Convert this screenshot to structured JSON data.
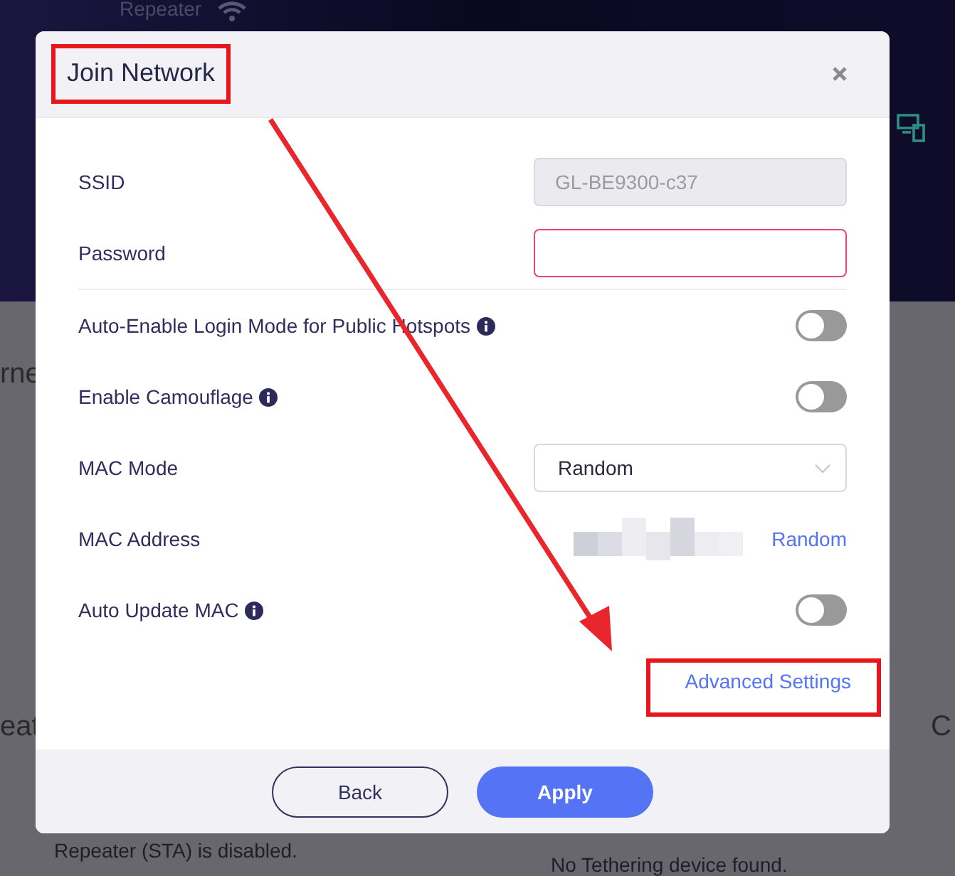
{
  "background": {
    "texts": [
      {
        "kind": "top-label",
        "text": "Repeater"
      },
      {
        "kind": "left-heading",
        "text": "rne"
      },
      {
        "kind": "left-heading-2",
        "text": "eat"
      },
      {
        "kind": "right-heading",
        "text": "C"
      },
      {
        "kind": "status-left",
        "text": "Repeater (STA) is disabled."
      },
      {
        "kind": "status-right",
        "text": "No Tethering device found."
      }
    ]
  },
  "dialog": {
    "title": "Join Network",
    "title_highlighted": true,
    "rows": [
      {
        "kind": "input",
        "label": "SSID",
        "value": "GL-BE9300-c37",
        "disabled": true,
        "invalid": false
      },
      {
        "kind": "input",
        "label": "Password",
        "value": "",
        "disabled": false,
        "invalid": true
      },
      {
        "kind": "toggle",
        "label": "Auto-Enable Login Mode for Public Hotspots",
        "info": true,
        "on": false
      },
      {
        "kind": "toggle",
        "label": "Enable Camouflage",
        "info": true,
        "on": false
      },
      {
        "kind": "select",
        "label": "MAC Mode",
        "value": "Random"
      },
      {
        "kind": "mac",
        "label": "MAC Address",
        "link": "Random"
      },
      {
        "kind": "toggle",
        "label": "Auto Update MAC",
        "info": true,
        "on": false
      }
    ],
    "advanced_link": {
      "text": "Advanced Settings",
      "highlighted": true
    },
    "buttons": [
      {
        "kind": "secondary",
        "label": "Back"
      },
      {
        "kind": "primary",
        "label": "Apply"
      }
    ]
  },
  "annotation_arrow": true
}
